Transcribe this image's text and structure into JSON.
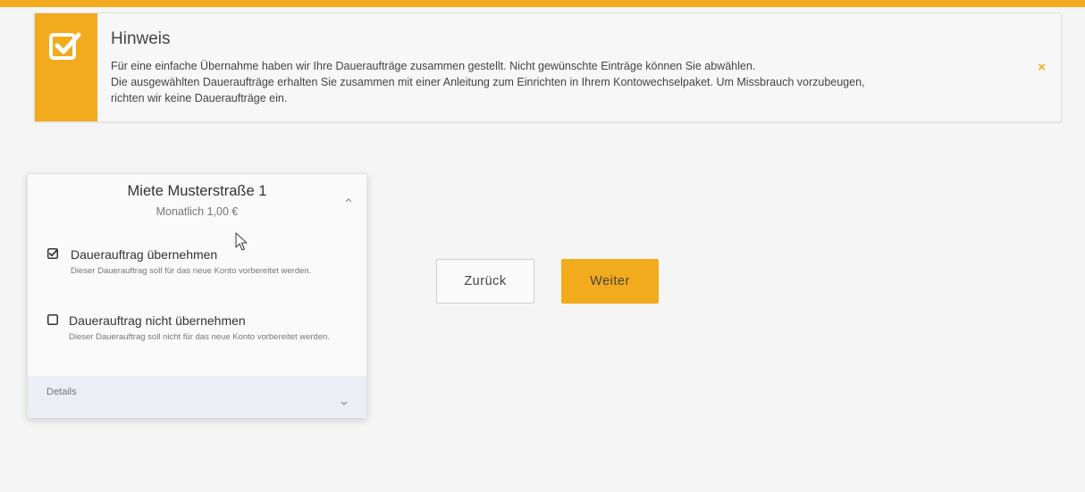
{
  "colors": {
    "accent": "#f2ab1c",
    "background": "#f5f5f5",
    "details_bar": "#eceef5"
  },
  "notice": {
    "icon": "checkbox-check-icon",
    "title": "Hinweis",
    "line1": "Für eine einfache Übernahme haben wir Ihre Daueraufträge zusammen gestellt. Nicht gewünschte Einträge können Sie abwählen.",
    "line2": "Die ausgewählten Daueraufträge erhalten Sie zusammen mit einer Anleitung zum Einrichten in Ihrem Kontowechselpaket. Um Missbrauch vorzubeugen,",
    "line3": "richten wir keine Daueraufträge ein.",
    "close_icon": "×"
  },
  "card": {
    "title": "Miete Musterstraße 1",
    "subtitle": "Monatlich 1,00 €",
    "options": [
      {
        "label": "Dauerauftrag übernehmen",
        "description": "Dieser Dauerauftrag soll für das neue Konto vorbereitet werden.",
        "checked": true
      },
      {
        "label": "Dauerauftrag nicht übernehmen",
        "description": "Dieser Dauerauftrag soll nicht für das neue Konto vorbereitet werden.",
        "checked": false
      }
    ],
    "details_label": "Details"
  },
  "buttons": {
    "back_label": "Zurück",
    "next_label": "Weiter"
  }
}
